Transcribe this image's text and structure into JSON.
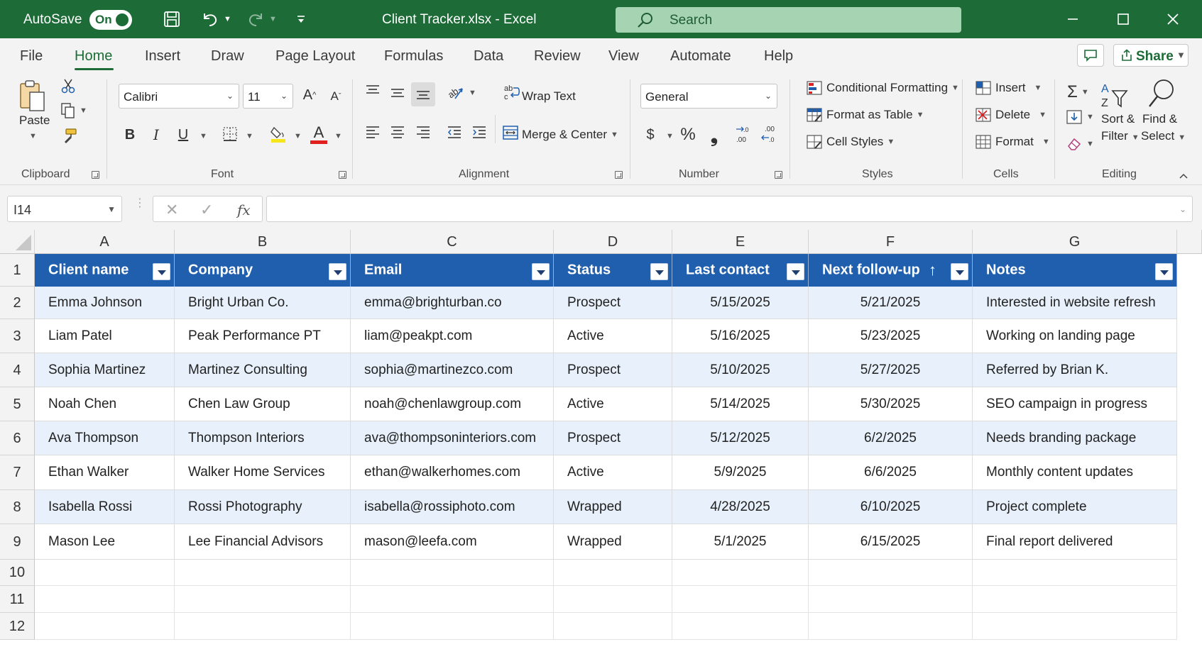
{
  "titlebar": {
    "autosave_label": "AutoSave",
    "autosave_state": "On",
    "file_title": "Client Tracker.xlsx  -  Excel",
    "search_placeholder": "Search"
  },
  "menu": {
    "tabs": [
      "File",
      "Home",
      "Insert",
      "Draw",
      "Page Layout",
      "Formulas",
      "Data",
      "Review",
      "View",
      "Automate",
      "Help"
    ],
    "active_tab": "Home",
    "share_label": "Share"
  },
  "ribbon": {
    "clipboard": {
      "paste_label": "Paste",
      "group_label": "Clipboard"
    },
    "font": {
      "font_name": "Calibri",
      "font_size": "11",
      "group_label": "Font",
      "bold": "B",
      "italic": "I",
      "underline": "U",
      "grow": "A",
      "shrink": "A",
      "font_color_glyph": "A"
    },
    "alignment": {
      "wrap_text": "Wrap Text",
      "merge_center": "Merge & Center",
      "group_label": "Alignment"
    },
    "number": {
      "format": "General",
      "currency": "$",
      "percent": "%",
      "comma": "❟",
      "group_label": "Number"
    },
    "styles": {
      "conditional_formatting": "Conditional Formatting",
      "format_as_table": "Format as Table",
      "cell_styles": "Cell Styles",
      "group_label": "Styles"
    },
    "cells": {
      "insert": "Insert",
      "delete": "Delete",
      "format": "Format",
      "group_label": "Cells"
    },
    "editing": {
      "sort_filter_1": "Sort &",
      "sort_filter_2": "Filter",
      "find_select_1": "Find &",
      "find_select_2": "Select",
      "group_label": "Editing"
    }
  },
  "formula_bar": {
    "name_box": "I14",
    "fx_label": "fx",
    "content": ""
  },
  "sheet": {
    "column_letters": [
      "A",
      "B",
      "C",
      "D",
      "E",
      "F",
      "G"
    ],
    "row_numbers": [
      "1",
      "2",
      "3",
      "4",
      "5",
      "6",
      "7",
      "8",
      "9",
      "10",
      "11",
      "12"
    ],
    "table_headers": [
      "Client name",
      "Company",
      "Email",
      "Status",
      "Last contact",
      "Next follow-up",
      "Notes"
    ],
    "sorted_column_arrow": "↑",
    "rows": [
      [
        "Emma Johnson",
        "Bright Urban Co.",
        "emma@brighturban.co",
        "Prospect",
        "5/15/2025",
        "5/21/2025",
        "Interested in website refresh"
      ],
      [
        "Liam Patel",
        "Peak Performance PT",
        "liam@peakpt.com",
        "Active",
        "5/16/2025",
        "5/23/2025",
        "Working on landing page"
      ],
      [
        "Sophia Martinez",
        "Martinez Consulting",
        "sophia@martinezco.com",
        "Prospect",
        "5/10/2025",
        "5/27/2025",
        "Referred by Brian K."
      ],
      [
        "Noah Chen",
        "Chen Law Group",
        "noah@chenlawgroup.com",
        "Active",
        "5/14/2025",
        "5/30/2025",
        "SEO campaign in progress"
      ],
      [
        "Ava Thompson",
        "Thompson Interiors",
        "ava@thompsoninteriors.com",
        "Prospect",
        "5/12/2025",
        "6/2/2025",
        "Needs branding package"
      ],
      [
        "Ethan Walker",
        "Walker Home Services",
        "ethan@walkerhomes.com",
        "Active",
        "5/9/2025",
        "6/6/2025",
        "Monthly content updates"
      ],
      [
        "Isabella Rossi",
        "Rossi Photography",
        "isabella@rossiphoto.com",
        "Wrapped",
        "4/28/2025",
        "6/10/2025",
        "Project complete"
      ],
      [
        "Mason Lee",
        "Lee Financial Advisors",
        "mason@leefa.com",
        "Wrapped",
        "5/1/2025",
        "6/15/2025",
        "Final report delivered"
      ]
    ]
  },
  "colors": {
    "excel_green": "#1d6c38",
    "table_header_blue": "#1f5fae",
    "band_row": "#e8f1fb",
    "ribbon_bg": "#f3f3f3"
  }
}
